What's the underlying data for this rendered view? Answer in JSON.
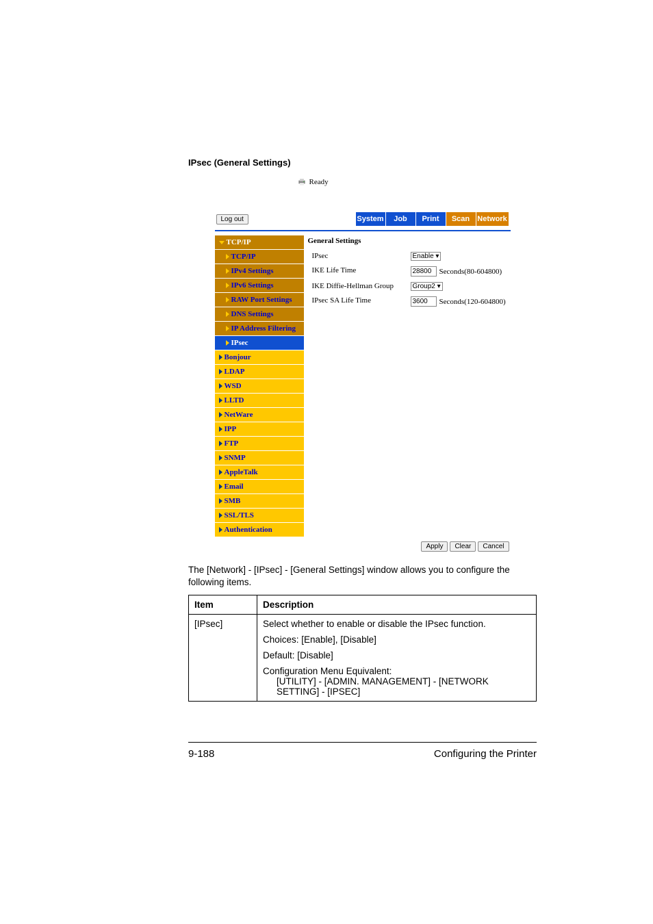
{
  "section_title": "IPsec (General Settings)",
  "status_label": "Ready",
  "logout_label": "Log out",
  "tabs": {
    "system": "System",
    "job": "Job",
    "print": "Print",
    "scan": "Scan",
    "network": "Network"
  },
  "sidebar": {
    "tcpip_group": "TCP/IP",
    "tcpip": "TCP/IP",
    "ipv4": "IPv4 Settings",
    "ipv6": "IPv6 Settings",
    "raw": "RAW Port Settings",
    "dns": "DNS Settings",
    "ipfilter": "IP Address Filtering",
    "ipsec": "IPsec",
    "bonjour": "Bonjour",
    "ldap": "LDAP",
    "wsd": "WSD",
    "lltd": "LLTD",
    "netware": "NetWare",
    "ipp": "IPP",
    "ftp": "FTP",
    "snmp": "SNMP",
    "appletalk": "AppleTalk",
    "email": "Email",
    "smb": "SMB",
    "ssltls": "SSL/TLS",
    "auth": "Authentication"
  },
  "content": {
    "title": "General Settings",
    "rows": {
      "ipsec_label": "IPsec",
      "ipsec_value": "Enable",
      "ike_label": "IKE Life Time",
      "ike_value": "28800",
      "ike_suffix": "Seconds(80-604800)",
      "dh_label": "IKE Diffie-Hellman Group",
      "dh_value": "Group2",
      "sa_label": "IPsec SA Life Time",
      "sa_value": "3600",
      "sa_suffix": "Seconds(120-604800)"
    }
  },
  "buttons": {
    "apply": "Apply",
    "clear": "Clear",
    "cancel": "Cancel"
  },
  "description": "The [Network] - [IPsec] - [General Settings] window allows you to configure the following items.",
  "table": {
    "headers": {
      "item": "Item",
      "desc": "Description"
    },
    "row1": {
      "item": "[IPsec]",
      "line1": "Select whether to enable or disable the IPsec function.",
      "line2": "Choices: [Enable], [Disable]",
      "line3": "Default: [Disable]",
      "line4a": "Configuration Menu Equivalent:",
      "line4b": "[UTILITY] - [ADMIN. MANAGEMENT] - [NETWORK SETTING] - [IPSEC]"
    }
  },
  "footer": {
    "page": "9-188",
    "title": "Configuring the Printer"
  },
  "chart_data": {
    "type": "table",
    "title": "IPsec General Settings parameters",
    "columns": [
      "Item",
      "Description"
    ],
    "rows": [
      [
        "[IPsec]",
        "Select whether to enable or disable the IPsec function. Choices: [Enable], [Disable]. Default: [Disable]. Configuration Menu Equivalent: [UTILITY] - [ADMIN. MANAGEMENT] - [NETWORK SETTING] - [IPSEC]"
      ]
    ]
  }
}
